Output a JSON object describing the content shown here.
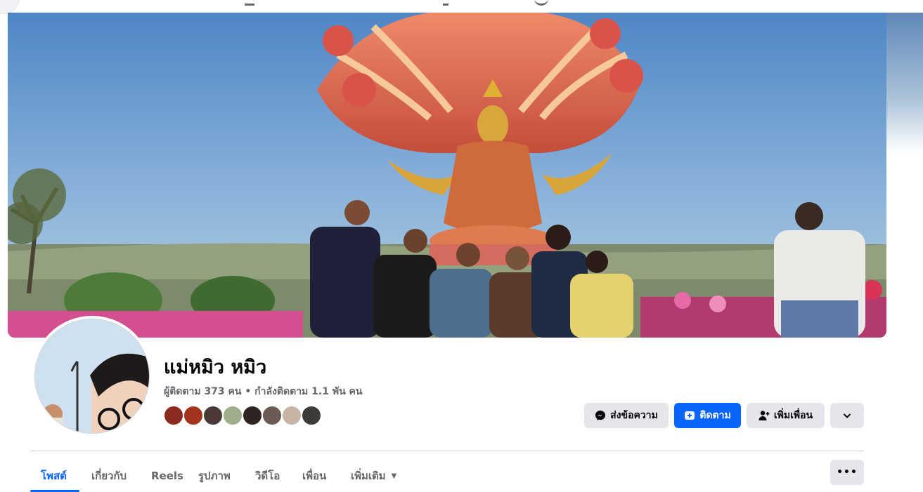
{
  "profile": {
    "name": "แม่หมิว หมิว",
    "stats": "ผู้ติดตาม 373 คน • กำลังติดตาม 1.1 พัน คน"
  },
  "actions": {
    "message_label": "ส่งข้อความ",
    "follow_label": "ติดตาม",
    "add_friend_label": "เพิ่มเพื่อน",
    "more_icon": "chevron-down-icon"
  },
  "tabs": [
    {
      "label": "โพสต์",
      "active": true
    },
    {
      "label": "เกี่ยวกับ",
      "active": false
    },
    {
      "label": "Reels",
      "active": false
    },
    {
      "label": "รูปภาพ",
      "active": false
    },
    {
      "label": "วิดีโอ",
      "active": false
    },
    {
      "label": "เพื่อน",
      "active": false
    },
    {
      "label": "เพิ่มเติม",
      "active": false
    }
  ],
  "tab_options_icon": "ellipsis-icon",
  "colors": {
    "accent": "#0866ff",
    "secondary_button": "#e4e6eb",
    "muted_text": "#65676b"
  }
}
